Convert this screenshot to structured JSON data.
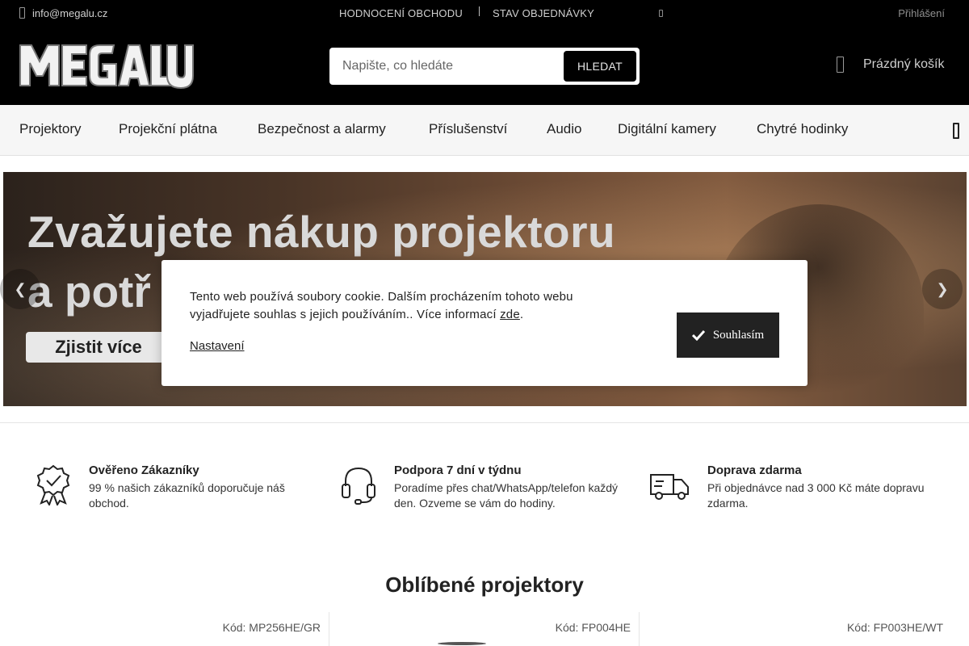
{
  "topbar": {
    "email": "info@megalu.cz",
    "links": [
      "HODNOCENÍ OBCHODU",
      "STAV OBJEDNÁVKY"
    ],
    "login": "Přihlášení"
  },
  "logo": {
    "text": "MEGALU"
  },
  "search": {
    "placeholder": "Napište, co hledáte",
    "button_label": "HLEDAT"
  },
  "cart": {
    "label": "Prázdný košík"
  },
  "categories": [
    "Projektory",
    "Projekční plátna",
    "Bezpečnost a alarmy",
    "Příslušenství",
    "Audio",
    "Digitální kamery",
    "Chytré hodinky"
  ],
  "hero": {
    "title_line1": "Zvažujete nákup projektoru",
    "title_line2": "a potř",
    "cta": "Zjistit více"
  },
  "cookie": {
    "text": "Tento web používá soubory cookie. Dalším procházením tohoto webu vyjadřujete souhlas s jejich používáním.. Více informací ",
    "link_label": "zde",
    "link_suffix": ".",
    "settings_label": "Nastavení",
    "accept_label": "Souhlasím"
  },
  "benefits": [
    {
      "icon": "ribbon-check-icon",
      "title": "Ověřeno Zákazníky",
      "desc": "99 % našich zákazníků doporučuje náš obchod."
    },
    {
      "icon": "headset-icon",
      "title": "Podpora 7 dní v týdnu",
      "desc": "Poradíme přes chat/WhatsApp/telefon každý den. Ozveme se vám do hodiny."
    },
    {
      "icon": "truck-icon",
      "title": "Doprava zdarma",
      "desc": "Při objednávce nad 3 000 Kč máte dopravu zdarma."
    }
  ],
  "section_title": "Oblíbené projektory",
  "products": [
    {
      "code": "Kód: MP256HE/GR"
    },
    {
      "code": "Kód: FP004HE"
    },
    {
      "code": "Kód: FP003HE/WT"
    }
  ]
}
